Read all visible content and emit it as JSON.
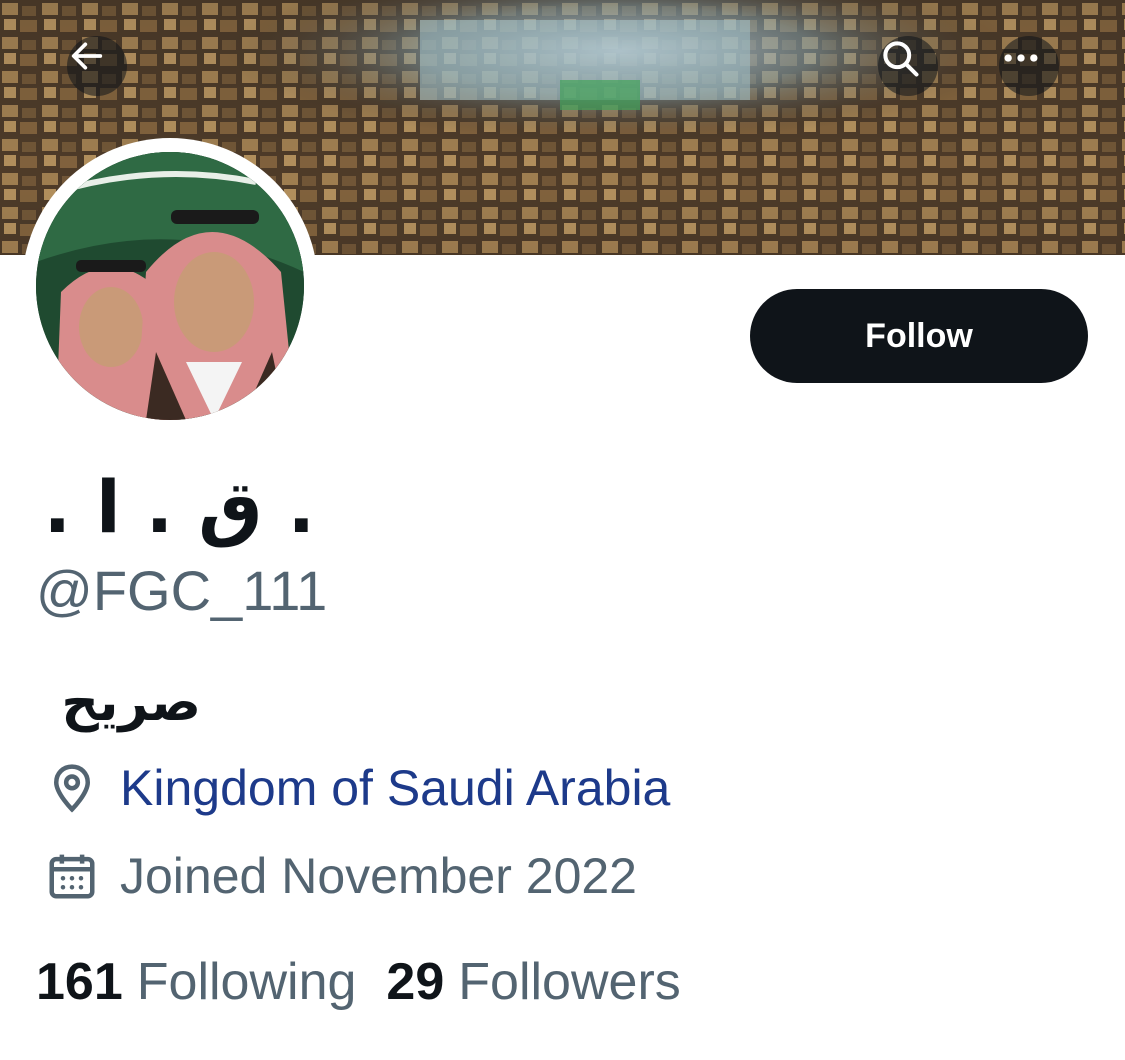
{
  "header": {
    "back_icon": "arrow-left-icon",
    "search_icon": "search-icon",
    "more_icon": "more-horizontal-icon"
  },
  "banner": {
    "description_icon": "city-banner-image"
  },
  "profile": {
    "avatar_icon": "profile-photo",
    "display_name": ". ق . ا .",
    "handle": "@FGC_111",
    "bio": "صريح",
    "location_icon": "location-pin-icon",
    "location": "Kingdom of Saudi Arabia",
    "joined_icon": "calendar-icon",
    "joined": "Joined November 2022"
  },
  "actions": {
    "follow_label": "Follow"
  },
  "stats": {
    "following_count": "161",
    "following_label": "Following",
    "followers_count": "29",
    "followers_label": "Followers"
  },
  "colors": {
    "primary_text": "#0f1419",
    "secondary_text": "#536471",
    "link": "#1d3a8a",
    "button_bg": "#0f1419"
  }
}
